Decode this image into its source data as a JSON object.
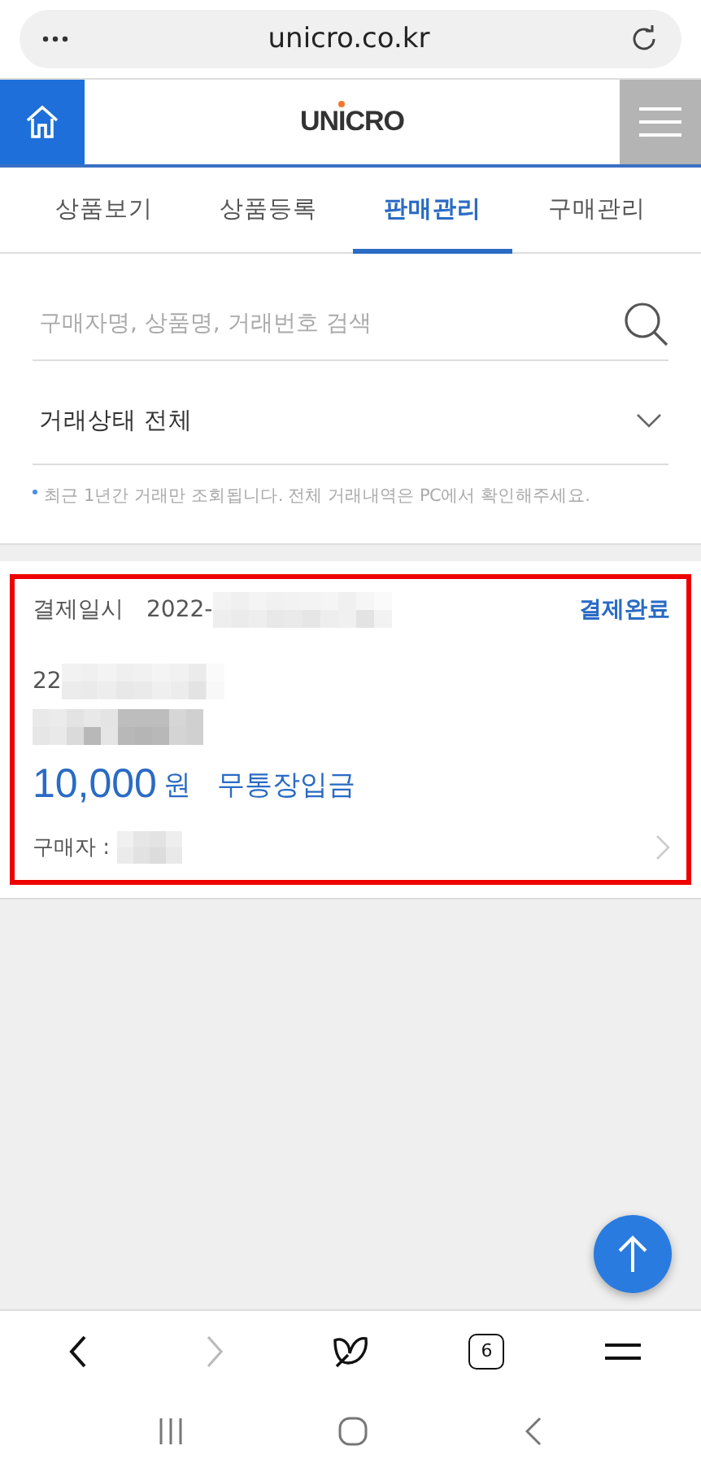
{
  "browser": {
    "url": "unicro.co.kr"
  },
  "header": {
    "logo": "UNICRO"
  },
  "tabs": [
    {
      "label": "상품보기",
      "selected": false
    },
    {
      "label": "상품등록",
      "selected": false
    },
    {
      "label": "판매관리",
      "selected": true
    },
    {
      "label": "구매관리",
      "selected": false
    }
  ],
  "search": {
    "placeholder": "구매자명, 상품명, 거래번호 검색"
  },
  "filter": {
    "value": "거래상태 전체"
  },
  "notice": "최근 1년간 거래만 조회됩니다. 전체 거래내역은 PC에서 확인해주세요.",
  "orders": [
    {
      "date_label": "결제일시",
      "date": "2022-",
      "status": "결제완료",
      "number": "22",
      "amount": "10,000",
      "currency": "원",
      "method": "무통장입금",
      "buyer_label": "구매자 :"
    }
  ],
  "toolbar": [
    {
      "kind": "back",
      "disabled": false
    },
    {
      "kind": "forward",
      "disabled": true
    },
    {
      "kind": "home",
      "disabled": false
    },
    {
      "kind": "tabs",
      "count": "6",
      "disabled": false
    },
    {
      "kind": "menu",
      "disabled": false
    }
  ]
}
